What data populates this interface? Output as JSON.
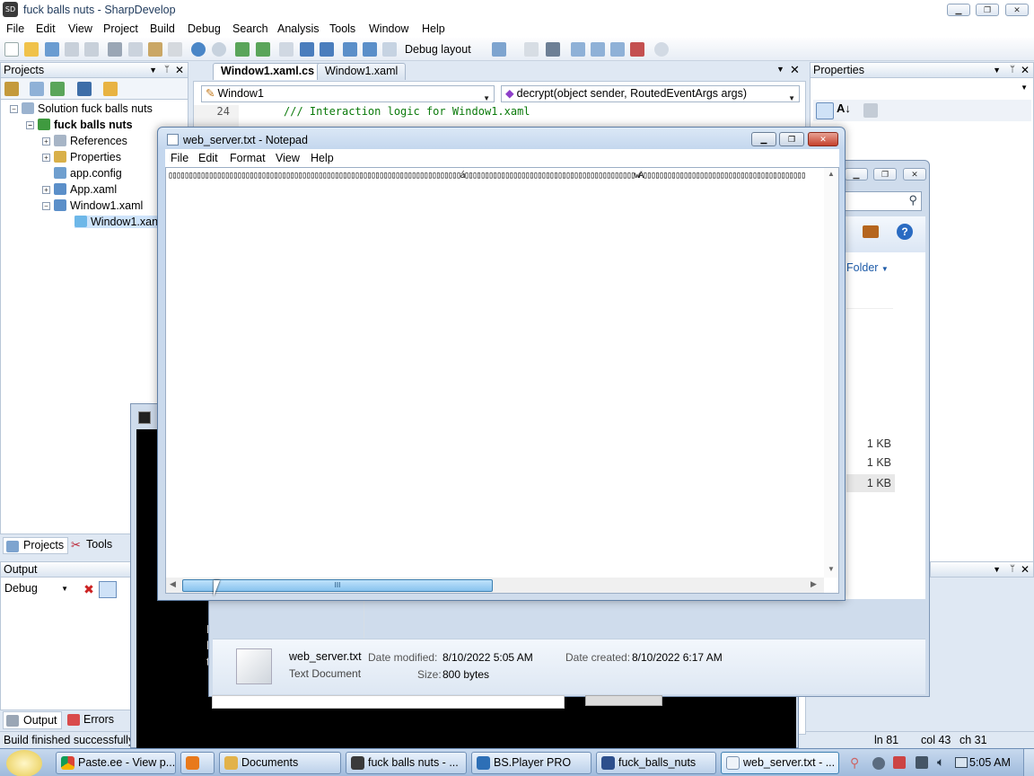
{
  "app": {
    "title": "fuck balls nuts - SharpDevelop",
    "icon_text": "SD"
  },
  "menu": [
    "File",
    "Edit",
    "View",
    "Project",
    "Build",
    "Debug",
    "Search",
    "Analysis",
    "Tools",
    "Window",
    "Help"
  ],
  "toolbar": {
    "debug_layout": "Debug layout"
  },
  "projects_pane": {
    "title": "Projects",
    "tree": [
      {
        "label": "Solution fuck balls nuts",
        "bold": false
      },
      {
        "label": "fuck balls nuts",
        "bold": true
      },
      {
        "label": "References",
        "bold": false
      },
      {
        "label": "Properties",
        "bold": false
      },
      {
        "label": "app.config",
        "bold": false
      },
      {
        "label": "App.xaml",
        "bold": false
      },
      {
        "label": "Window1.xaml",
        "bold": false
      },
      {
        "label": "Window1.xan",
        "bold": false
      }
    ],
    "tabs": [
      "Projects",
      "Tools"
    ]
  },
  "output_pane": {
    "title": "Output",
    "combo": "Debug",
    "tabs": [
      "Output",
      "Errors"
    ],
    "status": "Build finished successfully."
  },
  "editor": {
    "tabs": [
      "Window1.xaml.cs",
      "Window1.xaml"
    ],
    "class_combo": "Window1",
    "member_combo": "decrypt(object sender, RoutedEventArgs args)",
    "line_number": "24",
    "code_line": "/// Interaction logic for Window1.xaml",
    "status": {
      "ln": "ln 81",
      "col": "col 43",
      "ch": "ch 31"
    }
  },
  "properties_pane": {
    "title": "Properties"
  },
  "notepad": {
    "title": "web_server.txt - Notepad",
    "menu": [
      "File",
      "Edit",
      "Format",
      "View",
      "Help"
    ],
    "content": "▯▯▯▯▯▯▯▯▯▯▯▯▯▯▯▯▯▯▯▯▯▯▯▯▯▯▯▯▯▯▯▯▯▯▯▯▯▯▯▯▯▯▯▯▯▯▯▯▯▯▯▯▯▯▯▯▯▯▯▯▯▯▯▯▯▯▯▯▯▯▯▯á▯▯▯▯▯▯▯▯▯▯▯▯▯▯▯▯▯▯▯▯▯▯▯▯▯▯▯▯▯▯▯▯▯▯▯▯▯▯▯▯▯▯wÂ▯▯▯▯▯▯▯▯▯▯▯▯▯▯▯▯▯▯▯▯▯▯▯▯▯▯▯▯▯▯▯▯▯▯▯▯▯▯▯▯",
    "scroll_grip": "III"
  },
  "explorer": {
    "folder_btn": "Folder",
    "sizes": [
      "1 KB",
      "1 KB",
      "1 KB"
    ],
    "details": {
      "name": "web_server.txt",
      "type": "Text Document",
      "modified_label": "Date modified:",
      "modified": "8/10/2022 5:05 AM",
      "created_label": "Date created:",
      "created": "8/10/2022 6:17 AM",
      "size_label": "Size:",
      "size": "800 bytes"
    }
  },
  "console": {
    "lines": [
      "P",
      "h",
      "ti"
    ]
  },
  "taskbar": {
    "items": [
      "Paste.ee - View p...",
      "",
      "Documents",
      "fuck balls nuts - ...",
      "BS.Player PRO",
      "fuck_balls_nuts",
      "web_server.txt - ..."
    ],
    "clock": "5:05 AM"
  },
  "colors": {
    "accent": "#3b6ea5",
    "selection": "#cfe4fb",
    "scrollbar": "#88c2ee"
  }
}
